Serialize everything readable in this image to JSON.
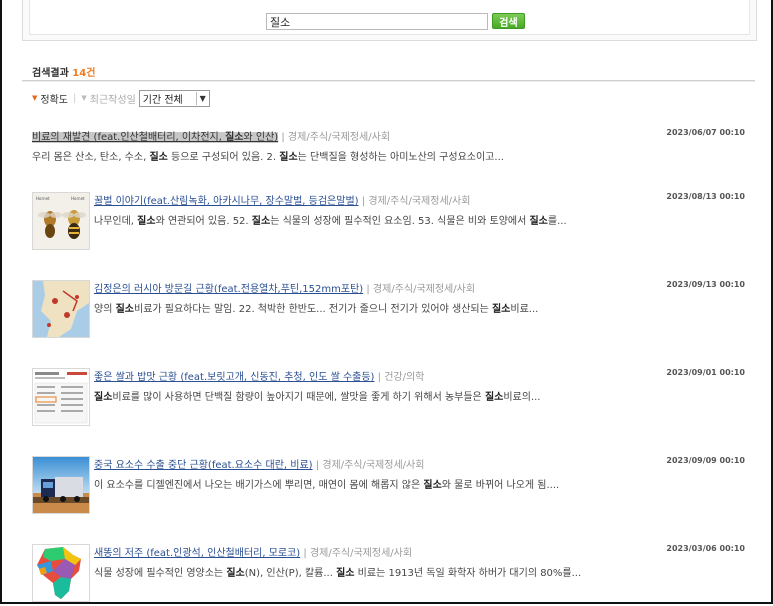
{
  "search": {
    "value": "질소",
    "button": "검색"
  },
  "results": {
    "label": "검색결과",
    "count": "14건"
  },
  "sort": {
    "accuracy": "정확도",
    "recent": "최근작성일",
    "period": "기간 전체"
  },
  "items": [
    {
      "title": "비료의 재발견 (feat.인산철배터리, 이차전지, 질소와 인산)",
      "category": "경제/주식/국제정세/사회",
      "date": "2023/06/07 00:10",
      "snippet": "우리 몸은 산소, 탄소, 수소, 질소 등으로 구성되어 있음. 2. 질소는 단백질을 형성하는 아미노산의 구성요소이고..."
    },
    {
      "title": "꿀벌 이야기(feat.산림녹화, 아카시나무, 장수말벌, 등검은말벌)",
      "category": "경제/주식/국제정세/사회",
      "date": "2023/08/13 00:10",
      "snippet": "나무인데, 질소와 연관되어 있음. 52. 질소는 식물의 성장에 필수적인 요소임. 53. 식물은 비와 토양에서 질소를...",
      "thumb_labels": [
        "Hornet",
        "Hornet"
      ]
    },
    {
      "title": "김정은의 러시아 방문길 근황(feat.전용열차,푸틴,152mm포탄)",
      "category": "경제/주식/국제정세/사회",
      "date": "2023/09/13 00:10",
      "snippet": "양의 질소비료가 필요하다는 말임. 22. 척박한 한반도... 전기가 줄으니 전기가 있어야 생산되는 질소비료..."
    },
    {
      "title": "좋은 쌀과 밥맛 근황 (feat.보릿고개, 신동진, 추청, 인도 쌀 수출등)",
      "category": "건강/의학",
      "date": "2023/09/01 00:10",
      "snippet": "질소비료를 많이 사용하면 단백질 함량이 높아지기 때문에, 쌀맛을 좋게 하기 위해서 농부들은 질소비료의..."
    },
    {
      "title": "중국 요소수 수출 중단 근황(feat.요소수 대란, 비료)",
      "category": "경제/주식/국제정세/사회",
      "date": "2023/09/09 00:10",
      "snippet": "이 요소수를 디젤엔진에서 나오는 배기가스에 뿌리면, 매연이 몸에 해롭지 않은 질소와 물로 바뀌어 나오게 됨...."
    },
    {
      "title": "새똥의 저주 (feat.인광석, 인산철배터리, 모로코)",
      "category": "경제/주식/국제정세/사회",
      "date": "2023/03/06 00:10",
      "snippet": "식물 성장에 필수적인 영양소는 질소(N), 인산(P), 칼륨... 질소 비료는 1913년 독일 화학자 하버가 대기의 80%를..."
    }
  ],
  "colors": {
    "accent": "#f07b1d",
    "link": "#2a4f93",
    "button": "#46a826"
  }
}
